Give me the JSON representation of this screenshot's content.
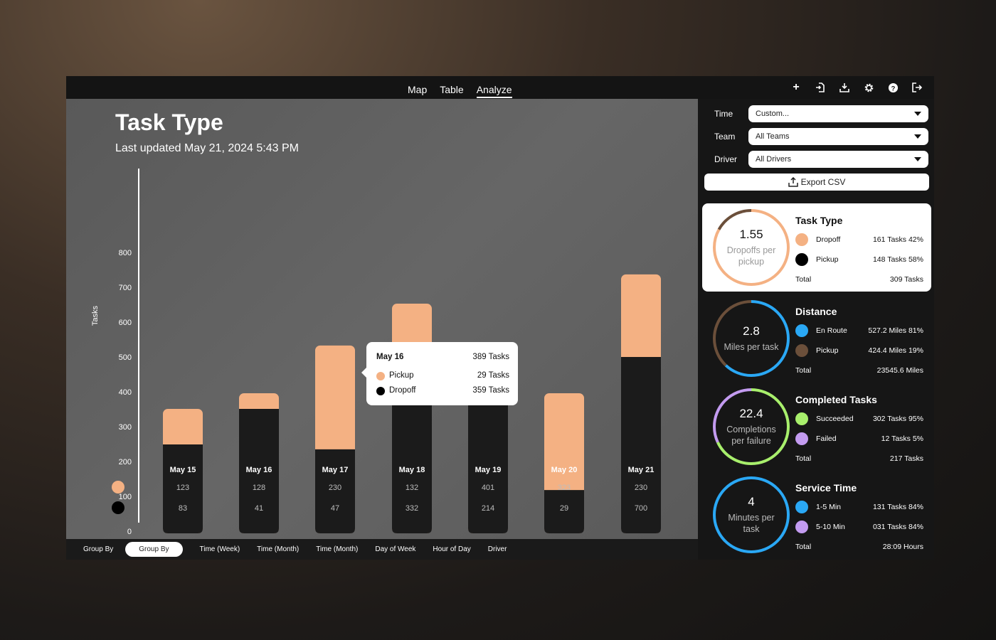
{
  "nav": {
    "tabs": [
      "Map",
      "Table",
      "Analyze"
    ],
    "active": "Analyze"
  },
  "toolbar_icons": [
    "plus-icon",
    "import-icon",
    "download-icon",
    "gear-icon",
    "help-icon",
    "logout-icon"
  ],
  "header": {
    "title": "Task Type",
    "subtitle": "Last updated May 21, 2024 5:43 PM"
  },
  "colors": {
    "pickup": "#f4b183",
    "dropoff": "#1b1b1b",
    "blue": "#2aa8f5",
    "brown": "#6b4f3a",
    "green": "#a8ef6c",
    "purple": "#c39bf0"
  },
  "chart_data": {
    "type": "bar",
    "stacked": true,
    "categories": [
      "May 15",
      "May 16",
      "May 17",
      "May 18",
      "May 19",
      "May 20",
      "May 21"
    ],
    "ylabel": "Tasks",
    "ylim": [
      0,
      800
    ],
    "yticks": [
      "0",
      "100",
      "200",
      "300",
      "400",
      "500",
      "600",
      "700",
      "800"
    ],
    "series": [
      {
        "color": "#1b1b1b",
        "values": [
          249,
          351,
          235,
          455,
          406,
          118,
          500
        ]
      },
      {
        "color": "#f4b183",
        "values": [
          102,
          45,
          298,
          198,
          65,
          278,
          237
        ]
      }
    ],
    "table_rows": [
      {
        "color": "#f4b183",
        "values": [
          "123",
          "128",
          "230",
          "132",
          "401",
          "323",
          "230"
        ]
      },
      {
        "color": "#000000",
        "values": [
          "83",
          "41",
          "47",
          "332",
          "214",
          "29",
          "700"
        ]
      }
    ],
    "tooltip": {
      "date": "May 16",
      "total": "389 Tasks",
      "rows": [
        {
          "label": "Pickup",
          "value": "29 Tasks",
          "color": "#f4b183"
        },
        {
          "label": "Dropoff",
          "value": "359 Tasks",
          "color": "#000000"
        }
      ]
    }
  },
  "groupby": {
    "label": "Group By",
    "options": [
      "Group By",
      "Time (Week)",
      "Time (Month)",
      "Time (Month)",
      "Day of Week",
      "Hour of Day",
      "Driver"
    ],
    "selected": "Group By"
  },
  "filters": [
    {
      "label": "Time",
      "value": "Custom..."
    },
    {
      "label": "Team",
      "value": "All Teams"
    },
    {
      "label": "Driver",
      "value": "All Drivers"
    }
  ],
  "export_label": "Export CSV",
  "cards": [
    {
      "title": "Task Type",
      "value": "1.55",
      "desc": "Dropoffs per pickup",
      "light": true,
      "ring": [
        {
          "color": "#f4b183",
          "fraction": 0.83
        },
        {
          "color": "#6b4f3a",
          "fraction": 0.17
        }
      ],
      "items": [
        {
          "label": "Dropoff",
          "value": "161 Tasks 42%",
          "color": "#f4b183"
        },
        {
          "label": "Pickup",
          "value": "148 Tasks 58%",
          "color": "#000000"
        }
      ],
      "total_label": "Total",
      "total": "309 Tasks"
    },
    {
      "title": "Distance",
      "value": "2.8",
      "desc": "Miles per task",
      "ring": [
        {
          "color": "#2aa8f5",
          "fraction": 0.62
        },
        {
          "color": "#6b4f3a",
          "fraction": 0.38
        }
      ],
      "items": [
        {
          "label": "En Route",
          "value": "527.2 Miles 81%",
          "color": "#2aa8f5"
        },
        {
          "label": "Pickup",
          "value": "424.4 Miles 19%",
          "color": "#6b4f3a"
        }
      ],
      "total_label": "Total",
      "total": "23545.6 Miles"
    },
    {
      "title": "Completed Tasks",
      "value": "22.4",
      "desc": "Completions per failure",
      "ring": [
        {
          "color": "#a8ef6c",
          "fraction": 0.68
        },
        {
          "color": "#c39bf0",
          "fraction": 0.32
        }
      ],
      "items": [
        {
          "label": "Succeeded",
          "value": "302 Tasks 95%",
          "color": "#a8ef6c"
        },
        {
          "label": "Failed",
          "value": "12 Tasks 5%",
          "color": "#c39bf0"
        }
      ],
      "total_label": "Total",
      "total": "217 Tasks"
    },
    {
      "title": "Service Time",
      "value": "4",
      "desc": "Minutes per task",
      "ring": [
        {
          "color": "#2aa8f5",
          "fraction": 1
        }
      ],
      "items": [
        {
          "label": "1-5 Min",
          "value": "131 Tasks 84%",
          "color": "#2aa8f5"
        },
        {
          "label": "5-10 Min",
          "value": "031 Tasks 84%",
          "color": "#c39bf0"
        }
      ],
      "total_label": "Total",
      "total": "28:09 Hours"
    }
  ]
}
